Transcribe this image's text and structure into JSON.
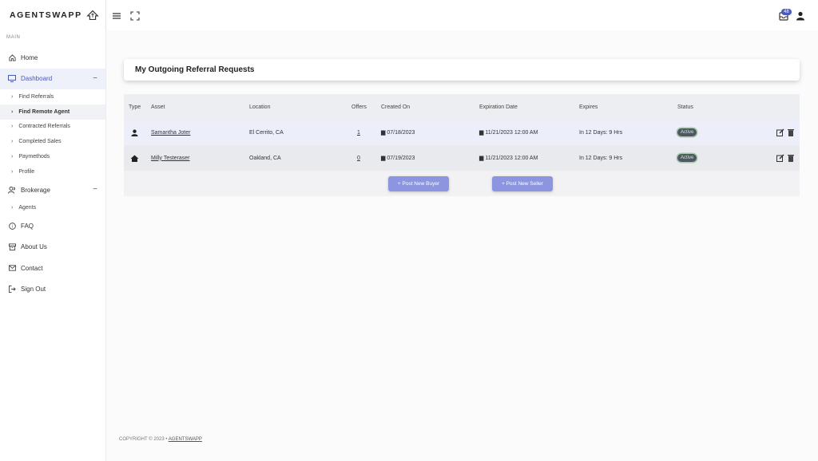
{
  "brand": {
    "name": "AGENTSWAPP"
  },
  "sidebar": {
    "section_label": "MAIN",
    "items": [
      {
        "label": "Home",
        "icon": "home-icon"
      },
      {
        "label": "Dashboard",
        "icon": "monitor-icon",
        "collapse": "−"
      },
      {
        "label": "Brokerage",
        "icon": "users-icon",
        "collapse": "−"
      },
      {
        "label": "FAQ",
        "icon": "help-circle-icon"
      },
      {
        "label": "About Us",
        "icon": "archive-icon"
      },
      {
        "label": "Contact",
        "icon": "mail-icon"
      },
      {
        "label": "Sign Out",
        "icon": "sign-out-icon"
      }
    ],
    "dashboard_sub": [
      "Find Referrals",
      "Find Remote Agent",
      "Contracted Referrals",
      "Completed Sales",
      "Paymethods",
      "Profile"
    ],
    "brokerage_sub": [
      "Agents"
    ]
  },
  "topbar": {
    "notification_count": "48"
  },
  "page": {
    "title": "My Outgoing Referral Requests"
  },
  "table": {
    "headers": {
      "type": "Type",
      "asset": "Asset",
      "location": "Location",
      "offers": "Offers",
      "created": "Created On",
      "expiration": "Expiration Date",
      "expires": "Expires",
      "status": "Status"
    },
    "rows": [
      {
        "type_icon": "user-icon",
        "asset": "Samantha Joter",
        "location": "El Cerrito, CA",
        "offers": "1",
        "created": "07/18/2023",
        "expiration": "11/21/2023 12:00 AM",
        "expires": "In 12 Days: 9 Hrs",
        "status": "Active"
      },
      {
        "type_icon": "house-icon",
        "asset": "Milly Testeraser",
        "location": "Oakland, CA",
        "offers": "0",
        "created": "07/19/2023",
        "expiration": "11/21/2023 12:00 AM",
        "expires": "In 12 Days: 9 Hrs",
        "status": "Active"
      }
    ],
    "buttons": {
      "post_buyer": "+ Post New Buyer",
      "post_seller": "+ Post New Seller"
    }
  },
  "footer": {
    "copyright": "COPYRIGHT © 2023  •",
    "link": "AGENTSWAPP"
  },
  "colors": {
    "accent": "#4a5ab8",
    "button": "#8c96e0"
  }
}
